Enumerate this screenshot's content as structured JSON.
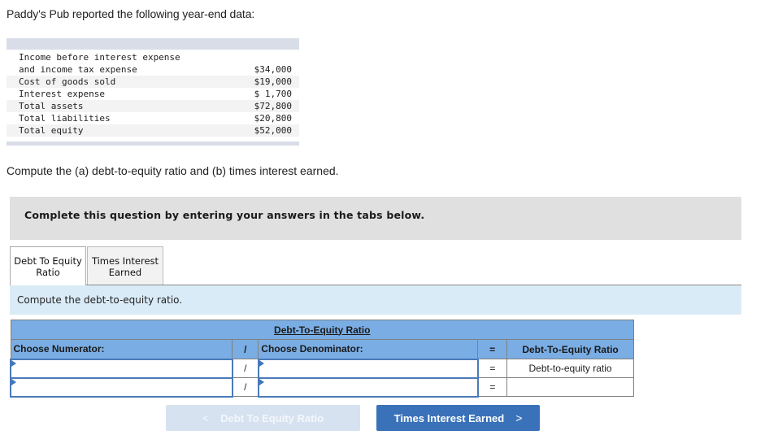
{
  "intro_text": "Paddy's Pub reported the following year-end data:",
  "data_table": {
    "rows": [
      {
        "label": "Income before interest expense",
        "value": ""
      },
      {
        "label": "and income tax expense",
        "value": "$34,000"
      },
      {
        "label": "Cost of goods sold",
        "value": "$19,000"
      },
      {
        "label": "Interest expense",
        "value": "$ 1,700"
      },
      {
        "label": "Total assets",
        "value": "$72,800"
      },
      {
        "label": "Total liabilities",
        "value": "$20,800"
      },
      {
        "label": "Total equity",
        "value": "$52,000"
      }
    ]
  },
  "question_text": "Compute the (a) debt-to-equity ratio and (b) times interest earned.",
  "instruction_banner": "Complete this question by entering your answers in the tabs below.",
  "tabs": [
    {
      "label_line1": "Debt To Equity",
      "label_line2": "Ratio",
      "active": true
    },
    {
      "label_line1": "Times Interest",
      "label_line2": "Earned",
      "active": false
    }
  ],
  "tab_panel_instruction": "Compute the debt-to-equity ratio.",
  "answer_table": {
    "title": "Debt-To-Equity Ratio",
    "headers": {
      "numerator": "Choose Numerator:",
      "divide": "/",
      "denominator": "Choose Denominator:",
      "equals": "=",
      "result": "Debt-To-Equity Ratio"
    },
    "rows": [
      {
        "numerator": "",
        "divide": "/",
        "denominator": "",
        "equals": "=",
        "result": "Debt-to-equity ratio"
      },
      {
        "numerator": "",
        "divide": "/",
        "denominator": "",
        "equals": "=",
        "result": ""
      }
    ]
  },
  "nav": {
    "prev_label": "Debt To Equity Ratio",
    "prev_chevron": "<",
    "next_label": "Times Interest Earned",
    "next_chevron": ">"
  },
  "colors": {
    "accent_blue": "#3a72b9",
    "table_header_blue": "#7aade4",
    "panel_light_blue": "#daebf8",
    "banner_gray": "#e0e0e0"
  }
}
